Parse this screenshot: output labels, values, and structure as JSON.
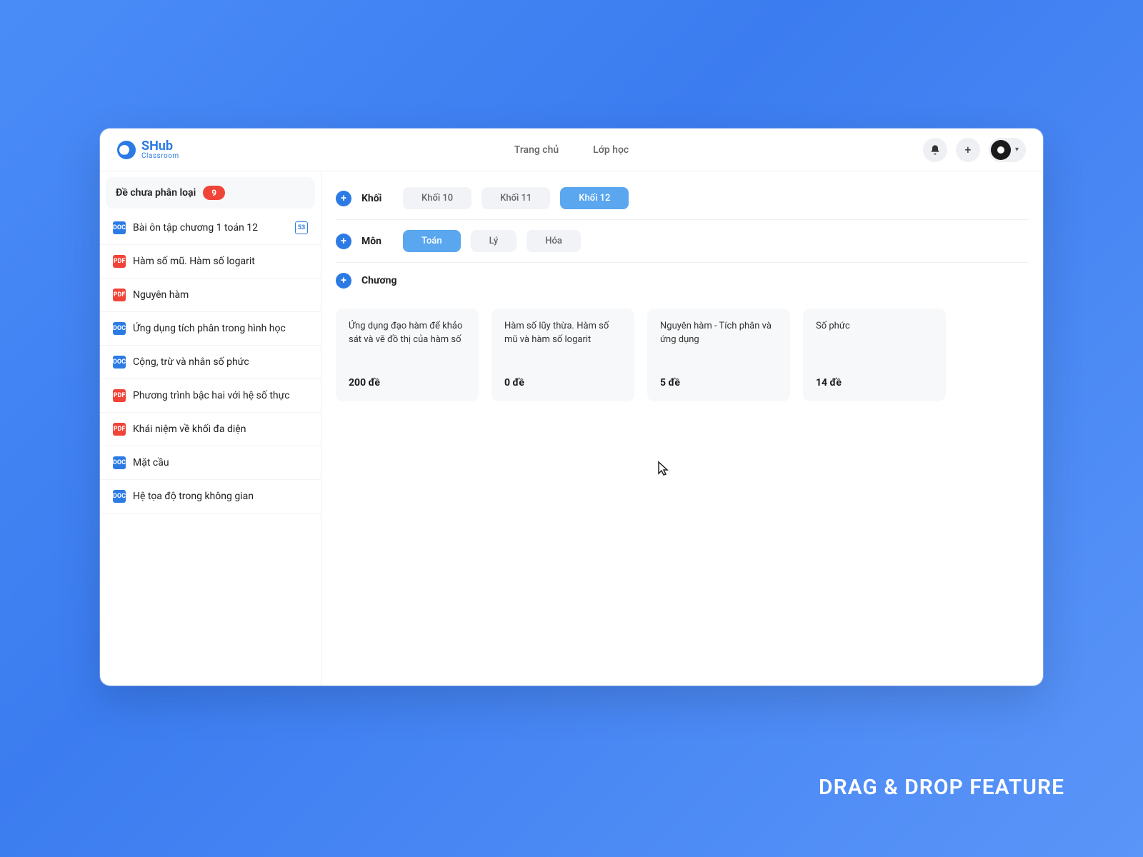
{
  "brand": {
    "title": "SHub",
    "subtitle": "Classroom"
  },
  "nav": {
    "home": "Trang chủ",
    "classes": "Lớp học"
  },
  "sidebar": {
    "unclassified": {
      "label": "Đề chưa phân loại",
      "count": "9"
    },
    "items": [
      {
        "icon": "doc",
        "label": "Bài ôn tập chương 1 toán 12",
        "badge": "53"
      },
      {
        "icon": "pdf",
        "label": "Hàm số mũ. Hàm số logarit"
      },
      {
        "icon": "pdf",
        "label": "Nguyên hàm"
      },
      {
        "icon": "doc",
        "label": "Ứng dụng tích phân trong hình học"
      },
      {
        "icon": "doc",
        "label": "Cộng, trừ và nhân số phức"
      },
      {
        "icon": "pdf",
        "label": "Phương trình bậc hai với hệ số thực"
      },
      {
        "icon": "pdf",
        "label": "Khái niệm về khối đa diện"
      },
      {
        "icon": "doc",
        "label": "Mặt cầu"
      },
      {
        "icon": "doc",
        "label": "Hệ tọa độ trong không gian"
      }
    ]
  },
  "filters": {
    "grade": {
      "label": "Khối",
      "options": [
        "Khối 10",
        "Khối 11",
        "Khối 12"
      ],
      "active": 2
    },
    "subject": {
      "label": "Môn",
      "options": [
        "Toán",
        "Lý",
        "Hóa"
      ],
      "active": 0
    },
    "chapter": {
      "label": "Chương"
    }
  },
  "cards": [
    {
      "title": "Ứng dụng đạo hàm để khảo sát và vẽ đồ thị của hàm số",
      "count": "200 đề"
    },
    {
      "title": "Hàm số lũy thừa. Hàm số mũ và hàm số logarit",
      "count": "0 đề"
    },
    {
      "title": "Nguyên hàm - Tích phân và ứng dụng",
      "count": "5 đề"
    },
    {
      "title": "Số phức",
      "count": "14 đề"
    }
  ],
  "caption": "DRAG & DROP FEATURE",
  "icons": {
    "doc": "DOC",
    "pdf": "PDF"
  }
}
